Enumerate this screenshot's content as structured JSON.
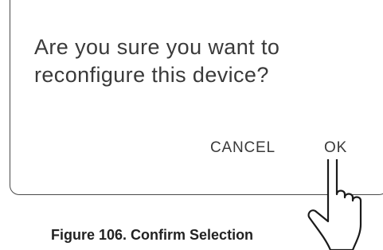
{
  "dialog": {
    "message_line1": "Are you sure you want to",
    "message_line2": "reconfigure this device?",
    "cancel_label": "CANCEL",
    "ok_label": "OK"
  },
  "caption": "Figure 106. Confirm Selection",
  "pointer_icon": "hand-pointer-icon"
}
